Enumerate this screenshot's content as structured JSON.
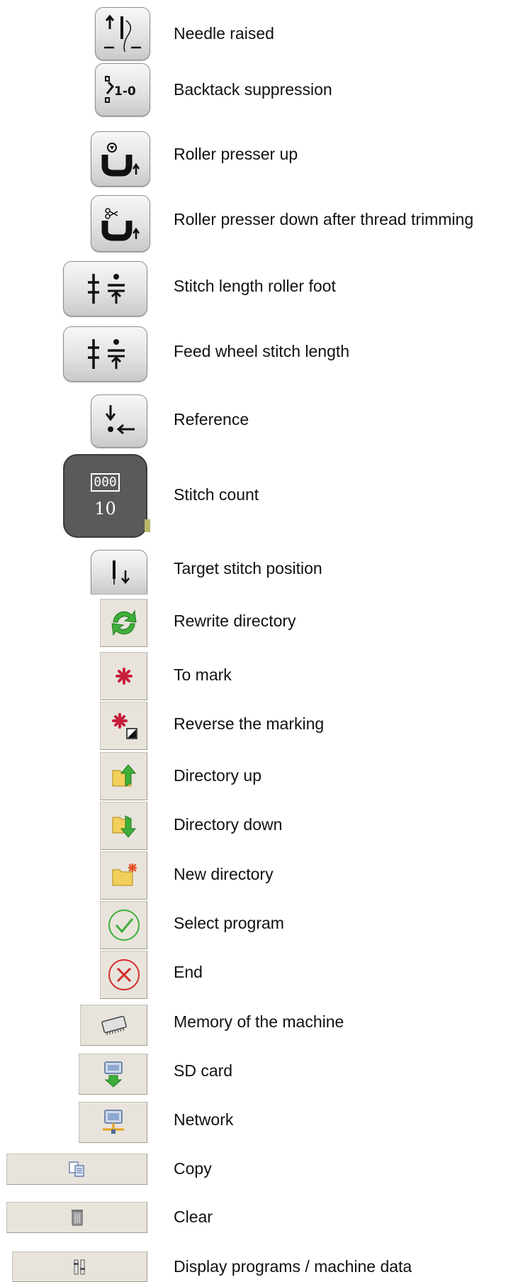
{
  "items": [
    {
      "label": "Needle raised",
      "icon": "needle-raised-icon"
    },
    {
      "label": "Backtack suppression",
      "icon": "backtack-suppression-icon",
      "glyph": "1-0"
    },
    {
      "label": "Roller presser up",
      "icon": "roller-presser-up-icon"
    },
    {
      "label": "Roller presser down after thread trimming",
      "icon": "roller-presser-down-trim-icon"
    },
    {
      "label": "Stitch length roller foot",
      "icon": "stitch-length-roller-foot-icon"
    },
    {
      "label": "Feed wheel stitch length",
      "icon": "feed-wheel-stitch-length-icon"
    },
    {
      "label": "Reference",
      "icon": "reference-icon"
    },
    {
      "label": "Stitch count",
      "icon": "stitch-count-icon",
      "counter_glyph": "000",
      "value": "10"
    },
    {
      "label": "Target stitch position",
      "icon": "target-stitch-position-icon"
    },
    {
      "label": "Rewrite directory",
      "icon": "rewrite-directory-icon"
    },
    {
      "label": "To mark",
      "icon": "to-mark-icon"
    },
    {
      "label": "Reverse the marking",
      "icon": "reverse-marking-icon"
    },
    {
      "label": "Directory up",
      "icon": "directory-up-icon"
    },
    {
      "label": "Directory down",
      "icon": "directory-down-icon"
    },
    {
      "label": "New directory",
      "icon": "new-directory-icon"
    },
    {
      "label": "Select program",
      "icon": "select-program-icon"
    },
    {
      "label": "End",
      "icon": "end-icon"
    },
    {
      "label": "Memory of the machine",
      "icon": "machine-memory-icon"
    },
    {
      "label": "SD card",
      "icon": "sd-card-icon"
    },
    {
      "label": "Network",
      "icon": "network-icon"
    },
    {
      "label": "Copy",
      "icon": "copy-icon"
    },
    {
      "label": "Clear",
      "icon": "trash-icon"
    },
    {
      "label": "Display programs / machine data",
      "icon": "display-programs-icon"
    }
  ],
  "colors": {
    "green": "#3fae3a",
    "red": "#d42a2a",
    "mark": "#c81e3c",
    "folder": "#f2cf5a"
  }
}
